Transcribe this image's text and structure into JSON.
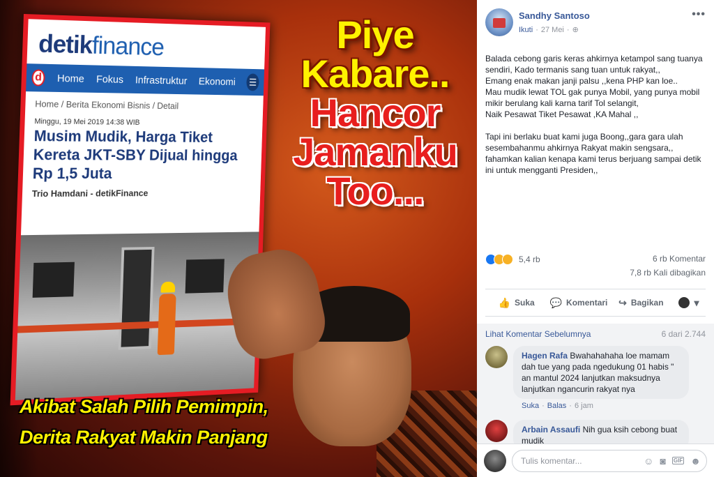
{
  "image": {
    "news_site": {
      "logo_part1": "detik",
      "logo_part2": "finance",
      "logo_badge": "d",
      "nav": [
        "Home",
        "Fokus",
        "Infrastruktur",
        "Ekonomi"
      ],
      "breadcrumb": "Home / Berita Ekonomi Bisnis / Detail",
      "date": "Minggu, 19 Mei 2019 14:38 WIB",
      "title": "Musim Mudik, Harga Tiket Kereta JKT-SBY Dijual hingga Rp 1,5 Juta",
      "author": "Trio Hamdani - detikFinance"
    },
    "headline_lines": [
      "Piye",
      "Kabare..",
      "Hancor",
      "Jamanku",
      "Too..."
    ],
    "caption_line1": "Akibat Salah Pilih Pemimpin,",
    "caption_line2": "Derita Rakyat Makin Panjang",
    "colors": {
      "frame_red": "#e51c24",
      "caption_yellow": "#fff200",
      "detik_blue": "#1e5fb0"
    }
  },
  "post": {
    "author": "Sandhy Santoso",
    "follow_label": "Ikuti",
    "separator": "·",
    "date": "27 Mei",
    "more_icon": "more-dots-icon",
    "body_paragraphs": [
      "Balada cebong garis keras ahkirnya ketampol sang tuanya sendiri, Kado termanis sang tuan untuk rakyat,,\nEmang enak makan janji palsu ,,kena PHP kan loe..\nMau mudik lewat TOL gak punya Mobil, yang punya mobil mikir berulang kali karna tarif Tol selangit,\nNaik Pesawat Tiket Pesawat ,KA Mahal ,,",
      "Tapi ini berlaku buat kami juga Boong,,gara gara ulah sesembahanmu ahkirnya Rakyat makin sengsara,,\nfahamkan kalian kenapa kami terus berjuang sampai detik ini untuk mengganti Presiden,,"
    ],
    "reaction_count": "5,4 rb",
    "comment_count": "6 rb Komentar",
    "share_count": "7,8 rb Kali dibagikan",
    "actions": {
      "like": "Suka",
      "comment": "Komentari",
      "share": "Bagikan"
    }
  },
  "comments": {
    "previous_link": "Lihat Komentar Sebelumnya",
    "previous_count": "6 dari 2.744",
    "items": [
      {
        "name": "Hagen Rafa",
        "text": "Bwahahahaha loe mamam dah tue yang pada ngedukung 01 habis \" an mantul 2024 lanjutkan maksudnya lanjutkan ngancurin rakyat nya",
        "like": "Suka",
        "reply": "Balas",
        "time": "6 jam"
      },
      {
        "name": "Arbain Assaufi",
        "text": "Nih gua ksih cebong buat mudik"
      }
    ],
    "compose_placeholder": "Tulis komentar...",
    "compose_icons": [
      "emoji-icon",
      "camera-icon",
      "gif-icon",
      "sticker-icon"
    ],
    "gif_label": "GIF"
  }
}
